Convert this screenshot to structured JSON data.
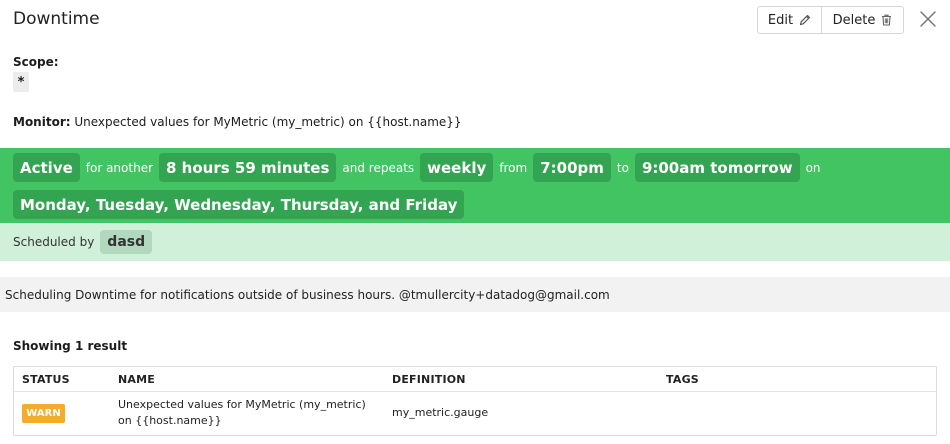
{
  "header": {
    "title": "Downtime"
  },
  "actions": {
    "edit_label": "Edit",
    "delete_label": "Delete"
  },
  "scope": {
    "label": "Scope:",
    "value": "*"
  },
  "monitor": {
    "label": "Monitor:",
    "value": "Unexpected values for MyMetric (my_metric) on {{host.name}}"
  },
  "status": {
    "state": "Active",
    "for_text": "for another",
    "duration": "8 hours 59 minutes",
    "repeats_text": "and repeats",
    "frequency": "weekly",
    "from_text": "from",
    "start_time": "7:00pm",
    "to_text": "to",
    "end_time": "9:00am tomorrow",
    "on_text": "on",
    "days": "Monday, Tuesday, Wednesday, Thursday, and Friday"
  },
  "schedule": {
    "label": "Scheduled by",
    "user": "dasd"
  },
  "message": "Scheduling Downtime for notifications outside of business hours. @tmullercity+datadog@gmail.com",
  "results": {
    "summary": "Showing 1 result",
    "columns": [
      "STATUS",
      "NAME",
      "DEFINITION",
      "TAGS"
    ],
    "rows": [
      {
        "status": "WARN",
        "name_line1": "Unexpected values for MyMetric (my_metric)",
        "name_line2": "on {{host.name}}",
        "definition": "my_metric.gauge",
        "tags": ""
      }
    ]
  },
  "colors": {
    "active_band": "#42c463",
    "chip": "#33a552",
    "schedule_band": "#d1f0da",
    "warn": "#f6ac2b"
  },
  "icons": {
    "edit": "pencil-icon",
    "delete": "trash-icon",
    "close": "close-icon"
  }
}
